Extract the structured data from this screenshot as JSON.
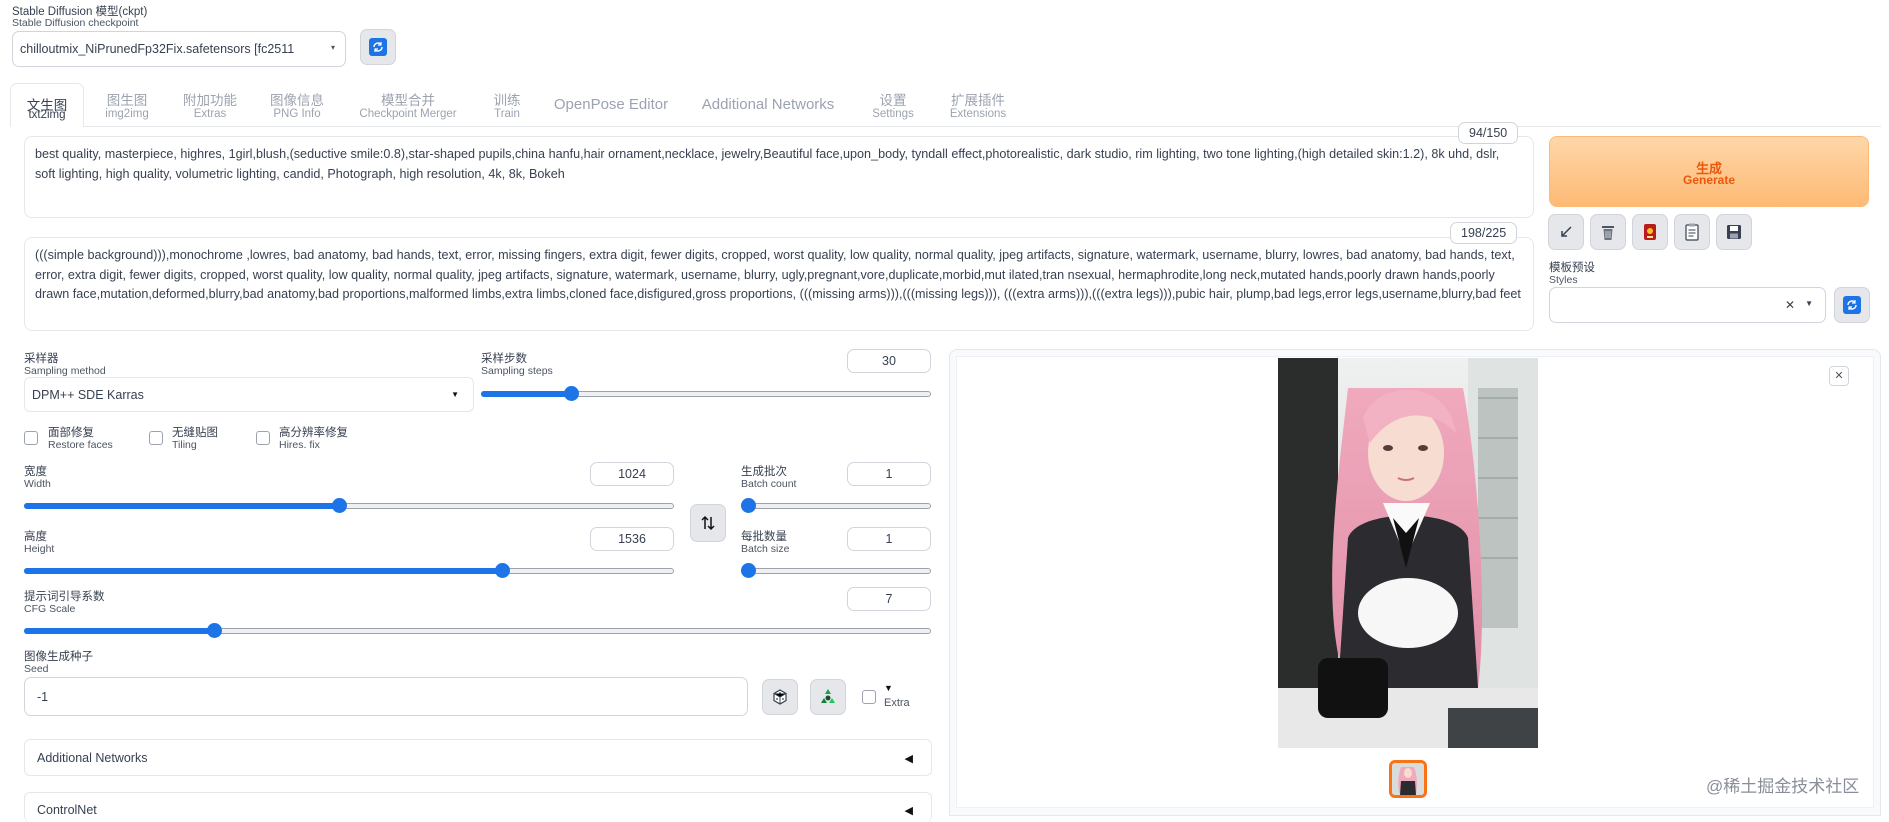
{
  "checkpoint": {
    "label_cn": "Stable Diffusion 模型(ckpt)",
    "label_en": "Stable Diffusion checkpoint",
    "value": "chilloutmix_NiPrunedFp32Fix.safetensors [fc2511",
    "refresh_icon": "refresh-icon"
  },
  "tabs": [
    {
      "cn": "文生图",
      "en": "txt2img",
      "active": true
    },
    {
      "cn": "图生图",
      "en": "img2img"
    },
    {
      "cn": "附加功能",
      "en": "Extras"
    },
    {
      "cn": "图像信息",
      "en": "PNG Info"
    },
    {
      "cn": "模型合并",
      "en": "Checkpoint Merger"
    },
    {
      "cn": "训练",
      "en": "Train"
    },
    {
      "single": "OpenPose Editor"
    },
    {
      "single": "Additional Networks"
    },
    {
      "cn": "设置",
      "en": "Settings"
    },
    {
      "cn": "扩展插件",
      "en": "Extensions"
    }
  ],
  "prompt": {
    "text": "best quality, masterpiece, highres, 1girl,blush,(seductive smile:0.8),star-shaped pupils,china hanfu,hair ornament,necklace, jewelry,Beautiful face,upon_body, tyndall effect,photorealistic, dark studio, rim lighting, two tone lighting,(high detailed skin:1.2), 8k uhd, dslr, soft lighting, high quality, volumetric lighting, candid, Photograph, high resolution, 4k, 8k, Bokeh",
    "counter": "94/150"
  },
  "negative_prompt": {
    "text": "(((simple background))),monochrome ,lowres, bad anatomy, bad hands, text, error, missing fingers, extra digit, fewer digits, cropped, worst quality, low quality, normal quality, jpeg artifacts, signature, watermark, username, blurry, lowres, bad anatomy, bad hands, text, error, extra digit, fewer digits, cropped, worst quality, low quality, normal quality, jpeg artifacts, signature, watermark, username, blurry, ugly,pregnant,vore,duplicate,morbid,mut ilated,tran nsexual, hermaphrodite,long neck,mutated hands,poorly drawn hands,poorly drawn face,mutation,deformed,blurry,bad anatomy,bad proportions,malformed limbs,extra limbs,cloned face,disfigured,gross proportions, (((missing arms))),(((missing legs))), (((extra arms))),(((extra legs))),pubic hair, plump,bad legs,error legs,username,blurry,bad feet",
    "counter": "198/225"
  },
  "generate": {
    "cn": "生成",
    "en": "Generate",
    "color": "#ea580c"
  },
  "tool_icons": [
    "arrow-diagonal-icon",
    "trash-icon",
    "red-card-icon",
    "clipboard-icon",
    "save-icon"
  ],
  "styles": {
    "label_cn": "模板预设",
    "label_en": "Styles",
    "clear": "✕"
  },
  "sampler": {
    "label_cn": "采样器",
    "label_en": "Sampling method",
    "value": "DPM++ SDE Karras"
  },
  "steps": {
    "label_cn": "采样步数",
    "label_en": "Sampling steps",
    "value": "30",
    "fraction": 0.2
  },
  "checkboxes": [
    {
      "cn": "面部修复",
      "en": "Restore faces"
    },
    {
      "cn": "无缝贴图",
      "en": "Tiling"
    },
    {
      "cn": "高分辨率修复",
      "en": "Hires. fix"
    }
  ],
  "width": {
    "label_cn": "宽度",
    "label_en": "Width",
    "value": "1024",
    "fraction": 0.485
  },
  "height": {
    "label_cn": "高度",
    "label_en": "Height",
    "value": "1536",
    "fraction": 0.735
  },
  "batch_count": {
    "label_cn": "生成批次",
    "label_en": "Batch count",
    "value": "1",
    "fraction": 0.0
  },
  "batch_size": {
    "label_cn": "每批数量",
    "label_en": "Batch size",
    "value": "1",
    "fraction": 0.0
  },
  "cfg": {
    "label_cn": "提示词引导系数",
    "label_en": "CFG Scale",
    "value": "7",
    "fraction": 0.21
  },
  "seed": {
    "label_cn": "图像生成种子",
    "label_en": "Seed",
    "value": "-1",
    "extra": "Extra",
    "extra_arrow": "▼"
  },
  "accordions": [
    {
      "title": "Additional Networks",
      "arrow": "◀"
    },
    {
      "title": "ControlNet",
      "arrow": "◀"
    }
  ],
  "output": {
    "close": "✕"
  },
  "watermark": "@稀土掘金技术社区",
  "accent": "#1d74e7"
}
